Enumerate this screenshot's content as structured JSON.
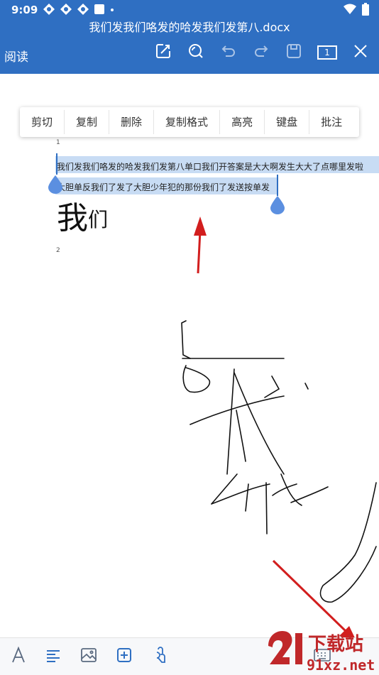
{
  "status": {
    "time": "9:09"
  },
  "header": {
    "title": "我们发我们咯发的哈发我们发第八.docx",
    "mode_label": "阅读",
    "page_number": "1"
  },
  "context_menu": {
    "items": [
      "剪切",
      "复制",
      "删除",
      "复制格式",
      "高亮",
      "键盘",
      "批注"
    ]
  },
  "document": {
    "para1_number": "1",
    "line1": "我们发我们咯发的哈发我们发第八单口我们开答案是大大啊发生大大了点哪里发啦",
    "line2": "大胆单反我们了发了大胆少年犯的那份我们了发送按单发",
    "big_main": "我",
    "big_sup": "们",
    "para2_number": "2"
  },
  "watermark": {
    "brand": "下载站",
    "domain": "91xz.net"
  },
  "colors": {
    "header": "#2f6fc2",
    "selection": "#c8dcf4",
    "handle": "#5b8fe0",
    "arrow": "#d21e1e"
  }
}
